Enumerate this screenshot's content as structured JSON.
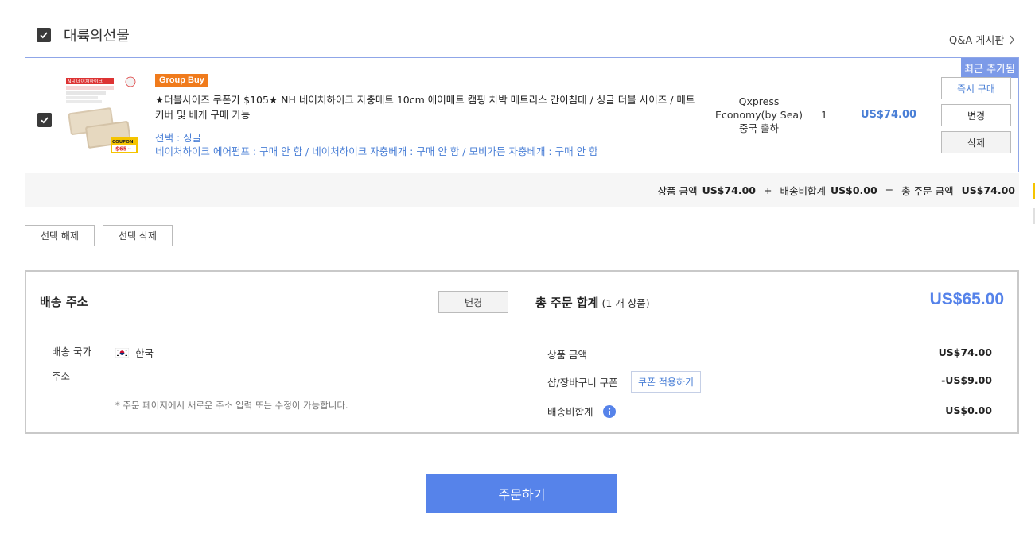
{
  "seller": {
    "name": "대륙의선물",
    "qa_link": "Q&A 게시판"
  },
  "item": {
    "recent_badge": "최근 추가됨",
    "group_badge": "Group Buy",
    "title": "★더블사이즈 쿠폰가 $105★ NH 네이처하이크 자충매트 10cm 에어매트 캠핑 차박 매트리스 간이침대 / 싱글 더블 사이즈 / 매트 커버 및 베개 구매 가능",
    "option_line1": "선택 : 싱글",
    "option_line2": "네이처하이크 에어펌프 : 구매 안 함 / 네이처하이크 자충베개 : 구매 안 함 / 모비가든 자충베개 : 구매 안 함",
    "shipping": [
      "Qxpress",
      "Economy(by Sea)",
      "중국 출하"
    ],
    "quantity": "1",
    "price": "US$74.00",
    "buttons": {
      "buy_now": "즉시 구매",
      "change": "변경",
      "delete": "삭제"
    },
    "thumbnail_text": {
      "headline": "NH 네이처하이크",
      "coupon": "COUPON",
      "coupon_price": "$65~"
    }
  },
  "summary": {
    "product_label": "상품 금액",
    "product_value": "US$74.00",
    "plus": "+",
    "shipping_label": "배송비합계",
    "shipping_value": "US$0.00",
    "equals": "=",
    "total_label": "총 주문 금액",
    "total_value": "US$74.00"
  },
  "actions": {
    "deselect": "선택 해제",
    "delete_selected": "선택 삭제"
  },
  "address": {
    "title": "배송 주소",
    "change_btn": "변경",
    "country_label": "배송 국가",
    "country_value": "한국",
    "address_label": "주소",
    "note": "* 주문 페이지에서 새로운 주소 입력 또는 수정이 가능합니다."
  },
  "order_total": {
    "title": "총 주문 합계",
    "count": "(1 개 상품)",
    "amount": "US$65.00",
    "rows": [
      {
        "label": "상품 금액",
        "value": "US$74.00"
      },
      {
        "label": "샵/장바구니 쿠폰",
        "value": "-US$9.00",
        "button": "쿠폰 적용하기"
      },
      {
        "label": "배송비합계",
        "value": "US$0.00"
      }
    ]
  },
  "order_button": "주문하기",
  "colors": {
    "accent": "#5683ea",
    "price_blue": "#4a7fd6",
    "group_orange": "#f07b1c",
    "border_blue": "#8fa6e8"
  }
}
